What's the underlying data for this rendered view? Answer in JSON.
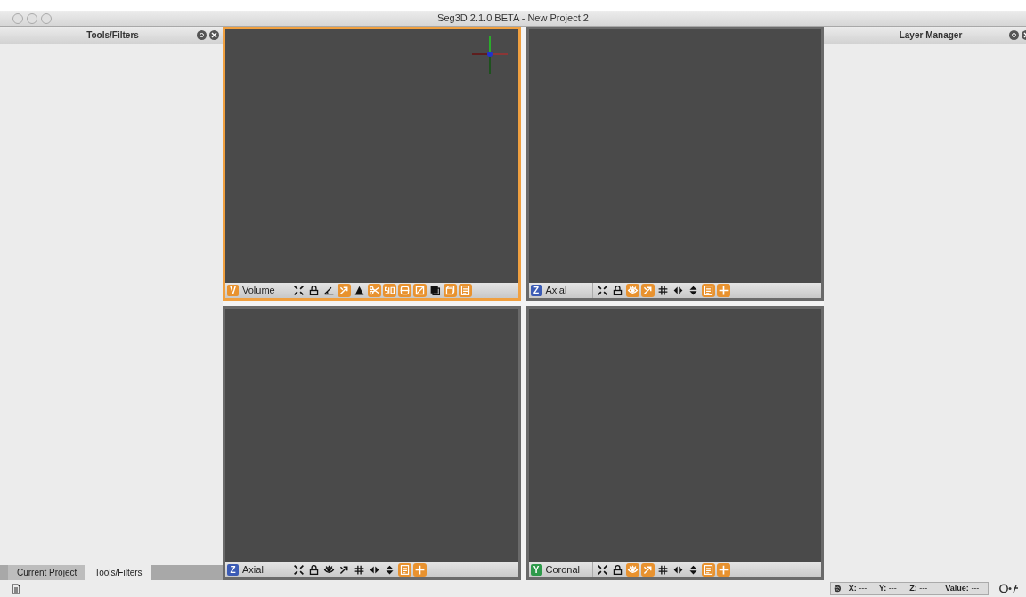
{
  "window": {
    "title": "Seg3D 2.1.0 BETA - New Project 2"
  },
  "left_panel": {
    "title": "Tools/Filters",
    "tabs": [
      {
        "label": "Current Project",
        "selected": false
      },
      {
        "label": "Tools/Filters",
        "selected": true
      }
    ]
  },
  "right_panel": {
    "title": "Layer Manager"
  },
  "viewers": [
    {
      "letter": "V",
      "label": "Volume",
      "color": "#e8922f",
      "selected": true,
      "axes": true,
      "tools": [
        {
          "kind": "fit",
          "on": false
        },
        {
          "kind": "lock",
          "on": false
        },
        {
          "kind": "ruler",
          "on": false
        },
        {
          "kind": "pick",
          "on": true
        },
        {
          "kind": "cone",
          "on": false
        },
        {
          "kind": "cut",
          "on": true
        },
        {
          "kind": "iso",
          "on": true
        },
        {
          "kind": "slices",
          "on": true
        },
        {
          "kind": "plane",
          "on": true
        },
        {
          "kind": "box",
          "on": false
        },
        {
          "kind": "cube",
          "on": true
        },
        {
          "kind": "text",
          "on": true
        }
      ]
    },
    {
      "letter": "Z",
      "label": "Axial",
      "color": "#3b5bb5",
      "selected": false,
      "axes": false,
      "tools": [
        {
          "kind": "fit",
          "on": false
        },
        {
          "kind": "lock",
          "on": false
        },
        {
          "kind": "eye",
          "on": true
        },
        {
          "kind": "pick",
          "on": true
        },
        {
          "kind": "grid",
          "on": false
        },
        {
          "kind": "fliph",
          "on": false
        },
        {
          "kind": "flipv",
          "on": false
        },
        {
          "kind": "text",
          "on": true
        },
        {
          "kind": "cross",
          "on": true
        }
      ]
    },
    {
      "letter": "Z",
      "label": "Axial",
      "color": "#3b5bb5",
      "selected": false,
      "axes": false,
      "tools": [
        {
          "kind": "fit",
          "on": false
        },
        {
          "kind": "lock",
          "on": false
        },
        {
          "kind": "eye",
          "on": false
        },
        {
          "kind": "pick",
          "on": false
        },
        {
          "kind": "grid",
          "on": false
        },
        {
          "kind": "fliph",
          "on": false
        },
        {
          "kind": "flipv",
          "on": false
        },
        {
          "kind": "text",
          "on": true
        },
        {
          "kind": "cross",
          "on": true
        }
      ]
    },
    {
      "letter": "Y",
      "label": "Coronal",
      "color": "#2e9a4a",
      "selected": false,
      "axes": false,
      "tools": [
        {
          "kind": "fit",
          "on": false
        },
        {
          "kind": "lock",
          "on": false
        },
        {
          "kind": "eye",
          "on": true
        },
        {
          "kind": "pick",
          "on": true
        },
        {
          "kind": "grid",
          "on": false
        },
        {
          "kind": "fliph",
          "on": false
        },
        {
          "kind": "flipv",
          "on": false
        },
        {
          "kind": "text",
          "on": true
        },
        {
          "kind": "cross",
          "on": true
        }
      ]
    }
  ],
  "status_bar": {
    "coords": [
      {
        "label": "X:",
        "value": "---"
      },
      {
        "label": "Y:",
        "value": "---"
      },
      {
        "label": "Z:",
        "value": "---"
      },
      {
        "label": "Value:",
        "value": "---"
      }
    ]
  }
}
